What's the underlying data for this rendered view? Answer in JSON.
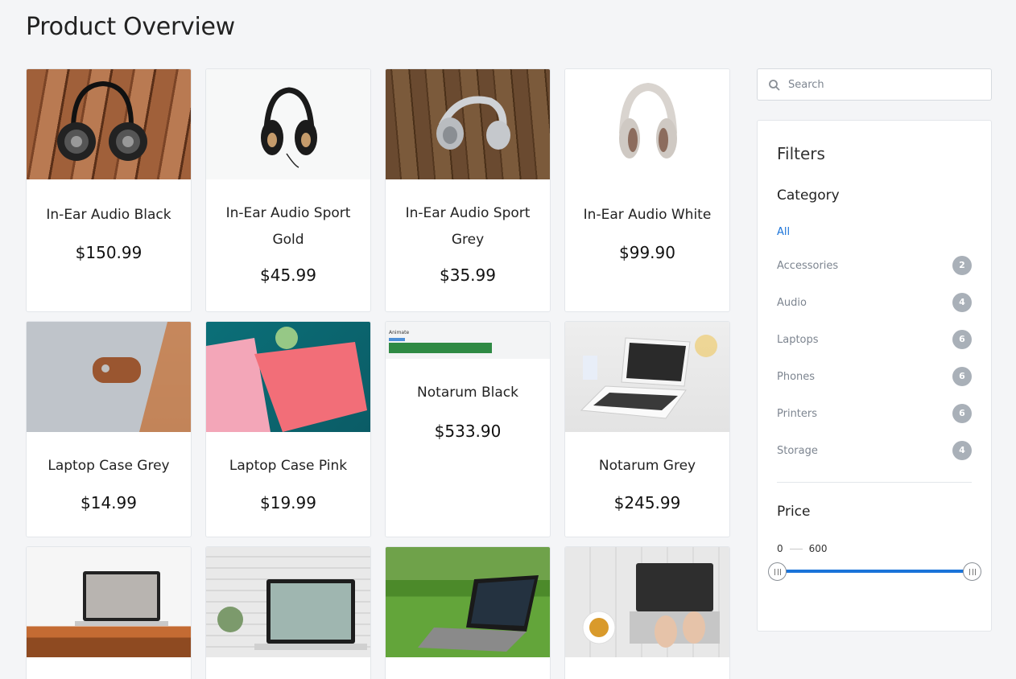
{
  "page": {
    "title": "Product Overview"
  },
  "products": [
    {
      "name": "In-Ear Audio Black",
      "price": "$150.99"
    },
    {
      "name": "In-Ear Audio Sport Gold",
      "price": "$45.99"
    },
    {
      "name": "In-Ear Audio Sport Grey",
      "price": "$35.99"
    },
    {
      "name": "In-Ear Audio White",
      "price": "$99.90"
    },
    {
      "name": "Laptop Case Grey",
      "price": "$14.99"
    },
    {
      "name": "Laptop Case Pink",
      "price": "$19.99"
    },
    {
      "name": "Notarum Black",
      "price": "$533.90",
      "image_text": "Animate"
    },
    {
      "name": "Notarum Grey",
      "price": "$245.99"
    },
    {
      "name": "",
      "price": ""
    },
    {
      "name": "",
      "price": ""
    },
    {
      "name": "",
      "price": ""
    },
    {
      "name": "",
      "price": ""
    }
  ],
  "search": {
    "placeholder": "Search",
    "icon": "search-icon"
  },
  "filters": {
    "title": "Filters",
    "category_title": "Category",
    "categories": [
      {
        "label": "All",
        "count": "",
        "active": true
      },
      {
        "label": "Accessories",
        "count": "2"
      },
      {
        "label": "Audio",
        "count": "4"
      },
      {
        "label": "Laptops",
        "count": "6"
      },
      {
        "label": "Phones",
        "count": "6"
      },
      {
        "label": "Printers",
        "count": "6"
      },
      {
        "label": "Storage",
        "count": "4"
      }
    ],
    "price_title": "Price",
    "price_min": "0",
    "price_max": "600"
  },
  "colors": {
    "accent": "#1a73d9",
    "badge": "#a9b0b8",
    "background": "#f4f5f7"
  }
}
